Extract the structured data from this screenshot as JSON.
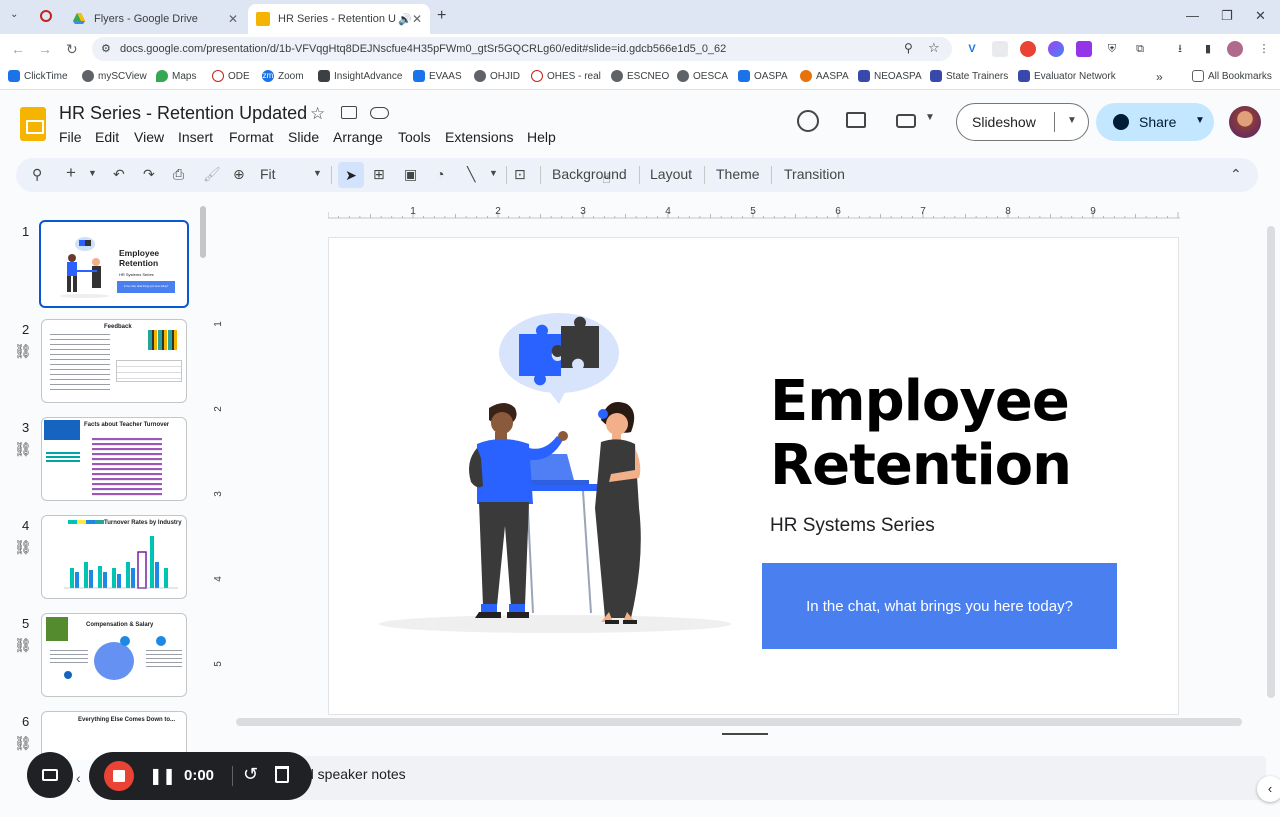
{
  "browser": {
    "tabs": [
      {
        "label": "Flyers - Google Drive",
        "active": false
      },
      {
        "label": "HR Series - Retention Upda",
        "active": true
      }
    ],
    "url": "docs.google.com/presentation/d/1b-VFVqgHtq8DEJNscfue4H35pFWm0_gtSr5GQCRLg60/edit#slide=id.gdcb566e1d5_0_62",
    "bookmarks": [
      "ClickTime",
      "mySCView",
      "Maps",
      "ODE",
      "Zoom",
      "InsightAdvance",
      "EVAAS",
      "OHJID",
      "OHES - real",
      "ESCNEO",
      "OESCA",
      "OASPA",
      "AASPA",
      "NEOASPA",
      "State Trainers",
      "Evaluator Network"
    ],
    "all_bookmarks": "All Bookmarks"
  },
  "doc": {
    "title": "HR Series - Retention Updated",
    "menu": [
      "File",
      "Edit",
      "View",
      "Insert",
      "Format",
      "Slide",
      "Arrange",
      "Tools",
      "Extensions",
      "Help"
    ],
    "slideshow_label": "Slideshow",
    "share_label": "Share"
  },
  "toolbar": {
    "zoom": "Fit",
    "background": "Background",
    "layout": "Layout",
    "theme": "Theme",
    "transition": "Transition"
  },
  "ruler": {
    "h": [
      "1",
      "2",
      "3",
      "4",
      "5",
      "6",
      "7",
      "8",
      "9"
    ],
    "v": [
      "1",
      "2",
      "3",
      "4",
      "5"
    ]
  },
  "filmstrip": [
    {
      "num": "1",
      "title": "Employee Retention",
      "subtitle": "HR Systems Series",
      "cta": "In the chat, what brings you here today?"
    },
    {
      "num": "2",
      "title": "Feedback"
    },
    {
      "num": "3",
      "title": "Facts about Teacher Turnover"
    },
    {
      "num": "4",
      "title": "Turnover Rates by Industry"
    },
    {
      "num": "5",
      "title": "Compensation & Salary"
    },
    {
      "num": "6",
      "title": "Everything Else Comes Down to..."
    }
  ],
  "slide": {
    "title_line1": "Employee",
    "title_line2": "Retention",
    "subtitle": "HR Systems Series",
    "cta": "In the chat, what brings you here today?"
  },
  "notes": {
    "placeholder": "d speaker notes"
  },
  "recorder": {
    "time": "0:00"
  },
  "colors": {
    "accent": "#0b57d0",
    "slide_cta": "#4a7ff0",
    "share_bg": "#c2e7ff",
    "doc_logo": "#f4b400"
  }
}
